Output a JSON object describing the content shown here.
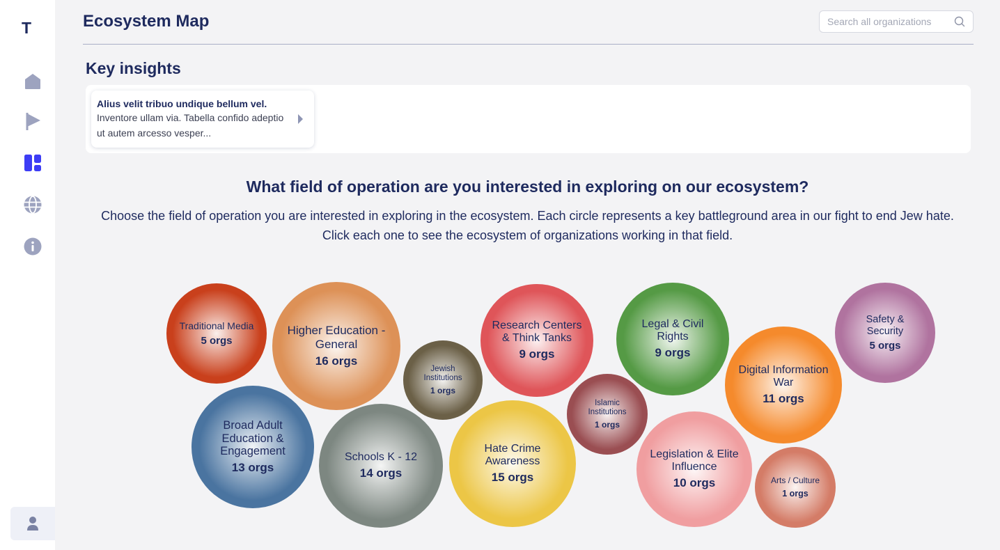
{
  "app": {
    "logo": "T",
    "page_title": "Ecosystem Map"
  },
  "sidebar": {
    "items": [
      {
        "name": "home",
        "icon": "home-icon",
        "active": false
      },
      {
        "name": "flag",
        "icon": "flag-icon",
        "active": false
      },
      {
        "name": "dashboard",
        "icon": "dashboard-icon",
        "active": true
      },
      {
        "name": "globe",
        "icon": "globe-icon",
        "active": false
      },
      {
        "name": "info",
        "icon": "info-icon",
        "active": false
      }
    ],
    "user_icon": "user-icon"
  },
  "search": {
    "placeholder": "Search all organizations",
    "icon": "search-icon"
  },
  "key_insights": {
    "title": "Key insights",
    "cards": [
      {
        "title": "Alius velit tribuo undique bellum vel.",
        "text": "Inventore ullam via. Tabella confido adeptio ut autem arcesso vesper..."
      }
    ]
  },
  "explore": {
    "question": "What field of operation are you interested in exploring on our ecosystem?",
    "line1": "Choose the field of operation you are interested in exploring in the ecosystem. Each circle represents a key battleground area in our fight to end Jew hate.",
    "line2": "Click each one to see the ecosystem of organizations working in that field."
  },
  "fields": [
    {
      "name": "Traditional Media",
      "count": "5 orgs",
      "color": "#c9401c"
    },
    {
      "name": "Higher Education - General",
      "count": "16 orgs",
      "color": "#dd9157"
    },
    {
      "name": "Jewish Institutions",
      "count": "1 orgs",
      "color": "#6b6047"
    },
    {
      "name": "Research Centers & Think Tanks",
      "count": "9 orgs",
      "color": "#df5559"
    },
    {
      "name": "Legal & Civil Rights",
      "count": "9 orgs",
      "color": "#559a45"
    },
    {
      "name": "Safety & Security",
      "count": "5 orgs",
      "color": "#b0739f"
    },
    {
      "name": "Digital Information War",
      "count": "11 orgs",
      "color": "#f58a2c"
    },
    {
      "name": "Islamic Institutions",
      "count": "1 orgs",
      "color": "#9a4e52"
    },
    {
      "name": "Broad Adult Education & Engagement",
      "count": "13 orgs",
      "color": "#4a74a0"
    },
    {
      "name": "Schools K - 12",
      "count": "14 orgs",
      "color": "#7d8781"
    },
    {
      "name": "Hate Crime Awareness",
      "count": "15 orgs",
      "color": "#ecc646"
    },
    {
      "name": "Legislation & Elite Influence",
      "count": "10 orgs",
      "color": "#f09ea0"
    },
    {
      "name": "Arts / Culture",
      "count": "1 orgs",
      "color": "#d47c67"
    }
  ],
  "colors": {
    "accent": "#3d3df5",
    "nav_inactive": "#9da3bf",
    "text": "#1e2a5e"
  }
}
